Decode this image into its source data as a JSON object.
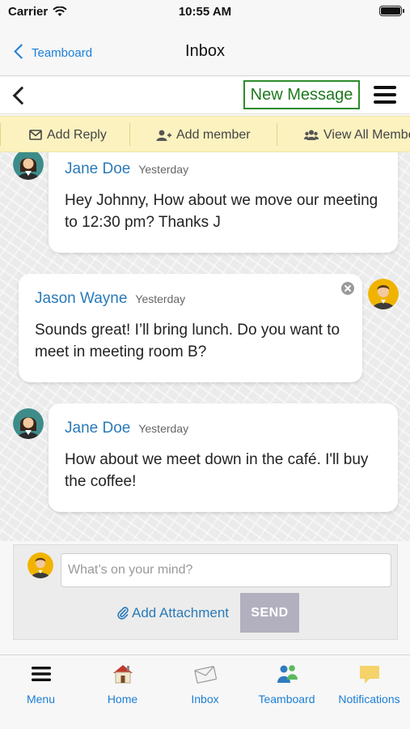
{
  "status_bar": {
    "carrier": "Carrier",
    "time": "10:55 AM"
  },
  "nav": {
    "back_label": "Teamboard",
    "title": "Inbox"
  },
  "toolbar": {
    "new_message_label": "New Message"
  },
  "actions": [
    {
      "label": "Add Reply",
      "icon": "envelope-icon"
    },
    {
      "label": "Add member",
      "icon": "add-user-icon"
    },
    {
      "label": "View All Members",
      "icon": "users-icon"
    }
  ],
  "messages": [
    {
      "author": "Jane Doe",
      "time": "Yesterday",
      "text": "Hey Johnny, How about we move our meeting to 12:30 pm? Thanks J",
      "side": "left",
      "avatar": "female-avatar"
    },
    {
      "author": "Jason Wayne",
      "time": "Yesterday",
      "text": "Sounds great! I’ll bring lunch. Do you want to meet in meeting room B?",
      "side": "right",
      "avatar": "male-avatar",
      "closable": true
    },
    {
      "author": "Jane Doe",
      "time": "Yesterday",
      "text": "How about we meet down in the café. I'll buy the coffee!",
      "side": "left",
      "avatar": "female-avatar"
    }
  ],
  "composer": {
    "placeholder": "What’s on your mind?",
    "value": "",
    "attachment_label": "Add Attachment",
    "send_label": "SEND"
  },
  "tabs": [
    {
      "label": "Menu",
      "icon": "menu-icon"
    },
    {
      "label": "Home",
      "icon": "home-icon"
    },
    {
      "label": "Inbox",
      "icon": "inbox-icon"
    },
    {
      "label": "Teamboard",
      "icon": "team-icon"
    },
    {
      "label": "Notifications",
      "icon": "notifications-icon"
    }
  ],
  "colors": {
    "accent": "#1c7ed6",
    "link": "#2a7ab8",
    "action_bar": "#fbf2c0",
    "new_message_border": "#2e8b2e",
    "send_disabled": "#b2b0bf"
  }
}
